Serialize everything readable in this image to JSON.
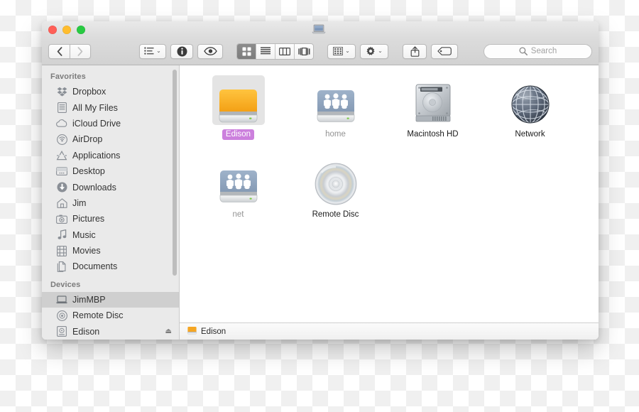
{
  "window": {
    "traffic_lights": [
      {
        "name": "close",
        "color": "#ff5f57"
      },
      {
        "name": "minimize",
        "color": "#ffbd2e"
      },
      {
        "name": "maximize",
        "color": "#28ca42"
      }
    ],
    "title": "",
    "proxy_icon": "macbook-icon"
  },
  "toolbar": {
    "back_label": "‹",
    "forward_label": "›",
    "arrange_icon": "list-lines-icon",
    "info_icon": "info-circle-icon",
    "quicklook_icon": "eye-icon",
    "view_modes": [
      {
        "name": "icon-view",
        "icon": "grid-icon",
        "active": true
      },
      {
        "name": "list-view",
        "icon": "lines-icon",
        "active": false
      },
      {
        "name": "column-view",
        "icon": "columns-icon",
        "active": false
      },
      {
        "name": "coverflow-view",
        "icon": "coverflow-icon",
        "active": false
      }
    ],
    "group_icon": "group-grid-icon",
    "action_icon": "gear-icon",
    "share_icon": "share-icon",
    "tag_icon": "tag-icon",
    "chevron": "⌄"
  },
  "search": {
    "placeholder": "Search",
    "value": "",
    "icon": "search-icon"
  },
  "sidebar": {
    "sections": [
      {
        "header": "Favorites",
        "items": [
          {
            "label": "Dropbox",
            "icon": "dropbox-icon",
            "selected": false,
            "eject": false
          },
          {
            "label": "All My Files",
            "icon": "all-my-files-icon",
            "selected": false,
            "eject": false
          },
          {
            "label": "iCloud Drive",
            "icon": "icloud-icon",
            "selected": false,
            "eject": false
          },
          {
            "label": "AirDrop",
            "icon": "airdrop-icon",
            "selected": false,
            "eject": false
          },
          {
            "label": "Applications",
            "icon": "applications-icon",
            "selected": false,
            "eject": false
          },
          {
            "label": "Desktop",
            "icon": "desktop-icon",
            "selected": false,
            "eject": false
          },
          {
            "label": "Downloads",
            "icon": "downloads-icon",
            "selected": false,
            "eject": false
          },
          {
            "label": "Jim",
            "icon": "home-icon",
            "selected": false,
            "eject": false
          },
          {
            "label": "Pictures",
            "icon": "pictures-icon",
            "selected": false,
            "eject": false
          },
          {
            "label": "Music",
            "icon": "music-icon",
            "selected": false,
            "eject": false
          },
          {
            "label": "Movies",
            "icon": "movies-icon",
            "selected": false,
            "eject": false
          },
          {
            "label": "Documents",
            "icon": "documents-icon",
            "selected": false,
            "eject": false
          }
        ]
      },
      {
        "header": "Devices",
        "items": [
          {
            "label": "JimMBP",
            "icon": "laptop-icon",
            "selected": true,
            "eject": false
          },
          {
            "label": "Remote Disc",
            "icon": "disc-icon",
            "selected": false,
            "eject": false
          },
          {
            "label": "Edison",
            "icon": "harddisk-icon",
            "selected": false,
            "eject": true
          }
        ]
      }
    ],
    "eject_glyph": "⏏"
  },
  "main": {
    "items": [
      {
        "label": "Edison",
        "icon": "external-drive-orange-icon",
        "selected": true,
        "dim": false
      },
      {
        "label": "home",
        "icon": "shared-folder-drive-icon",
        "selected": false,
        "dim": true
      },
      {
        "label": "Macintosh HD",
        "icon": "internal-harddrive-icon",
        "selected": false,
        "dim": false
      },
      {
        "label": "Network",
        "icon": "network-globe-icon",
        "selected": false,
        "dim": false
      },
      {
        "label": "net",
        "icon": "shared-folder-drive-icon",
        "selected": false,
        "dim": true
      },
      {
        "label": "Remote Disc",
        "icon": "optical-disc-icon",
        "selected": false,
        "dim": false
      }
    ]
  },
  "statusbar": {
    "label": "Edison",
    "icon": "mini-orange-drive-icon"
  },
  "colors": {
    "selection_label": "#cc80dd",
    "sidebar_selection": "#cfcfcf",
    "drive_orange": "#f5a623",
    "accent_view_active": "#828282"
  }
}
